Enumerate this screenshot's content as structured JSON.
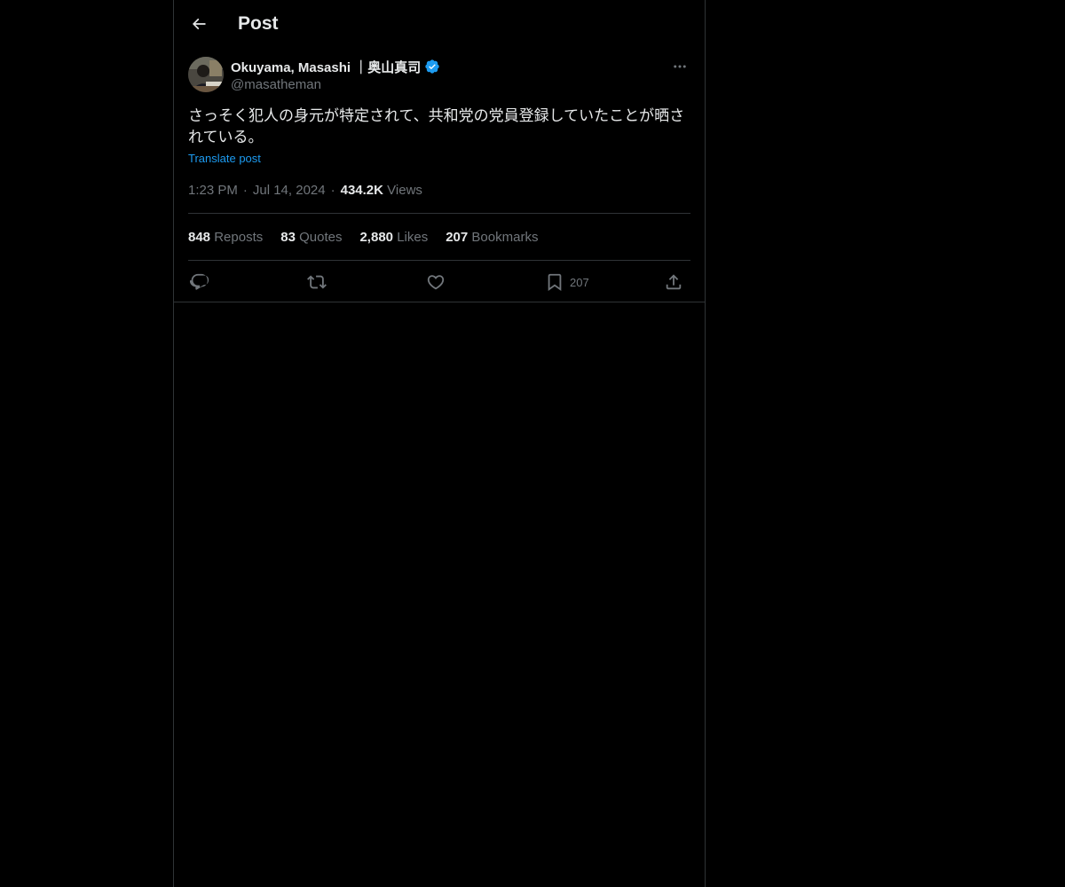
{
  "header": {
    "title": "Post",
    "back_icon": "arrow-left-icon"
  },
  "author": {
    "display_name": "Okuyama, Masashi ｜奥山真司",
    "handle": "@masatheman",
    "verified": true,
    "verified_color": "#1d9bf0"
  },
  "post": {
    "text": "さっそく犯人の身元が特定されて、共和党の党員登録していたことが晒されている。",
    "translate_label": "Translate post",
    "time": "1:23 PM",
    "date": "Jul 14, 2024",
    "views_count": "434.2K",
    "views_label": "Views"
  },
  "stats": {
    "reposts": {
      "count": "848",
      "label": "Reposts"
    },
    "quotes": {
      "count": "83",
      "label": "Quotes"
    },
    "likes": {
      "count": "2,880",
      "label": "Likes"
    },
    "bookmarks": {
      "count": "207",
      "label": "Bookmarks"
    }
  },
  "actions": {
    "reply_icon": "reply-icon",
    "repost_icon": "repost-icon",
    "like_icon": "heart-icon",
    "bookmark_icon": "bookmark-icon",
    "bookmark_count": "207",
    "share_icon": "share-icon"
  },
  "colors": {
    "background": "#000000",
    "text": "#e7e9ea",
    "secondary": "#71767b",
    "link": "#1d9bf0",
    "border": "#2f3336"
  }
}
